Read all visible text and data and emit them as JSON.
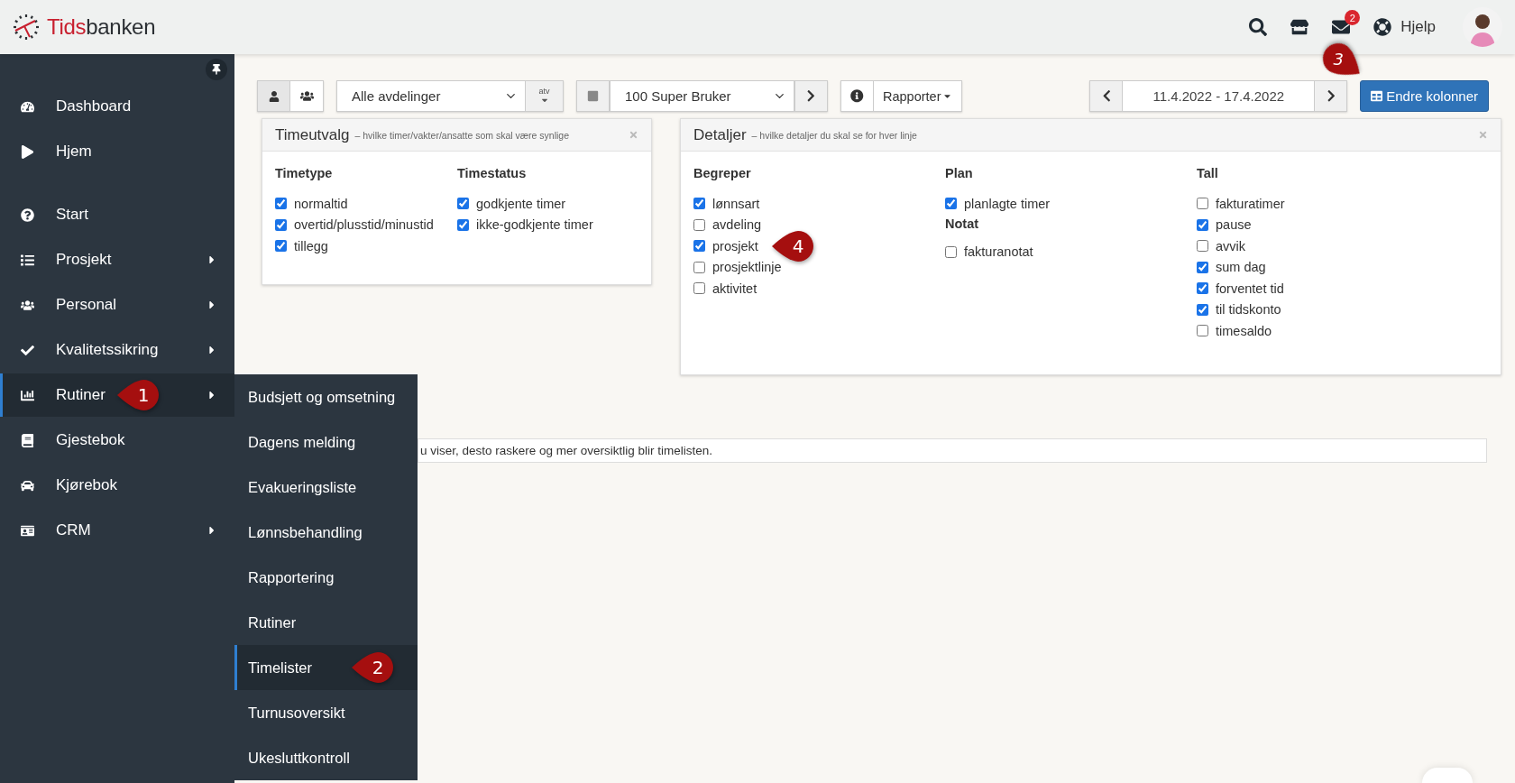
{
  "header": {
    "logo": [
      "Tids",
      "banken"
    ],
    "mail_badge": "2",
    "help": "Hjelp"
  },
  "sidebar": {
    "sections": [
      [
        {
          "label": "Dashboard",
          "submenu": false,
          "selected": false
        },
        {
          "label": "Hjem",
          "submenu": false,
          "selected": false
        }
      ],
      [
        {
          "label": "Start",
          "submenu": false,
          "selected": false
        },
        {
          "label": "Prosjekt",
          "submenu": true,
          "selected": false
        },
        {
          "label": "Personal",
          "submenu": true,
          "selected": false
        },
        {
          "label": "Kvalitetssikring",
          "submenu": true,
          "selected": false
        },
        {
          "label": "Rutiner",
          "submenu": true,
          "selected": true,
          "callout": "1"
        },
        {
          "label": "Gjestebok",
          "submenu": false,
          "selected": false
        },
        {
          "label": "Kjørebok",
          "submenu": false,
          "selected": false
        },
        {
          "label": "CRM",
          "submenu": true,
          "selected": false
        }
      ]
    ]
  },
  "submenu": {
    "items": [
      {
        "label": "Budsjett og omsetning",
        "selected": false
      },
      {
        "label": "Dagens melding",
        "selected": false
      },
      {
        "label": "Evakueringsliste",
        "selected": false
      },
      {
        "label": "Lønnsbehandling",
        "selected": false
      },
      {
        "label": "Rapportering",
        "selected": false
      },
      {
        "label": "Rutiner",
        "selected": false
      },
      {
        "label": "Timelister",
        "selected": true,
        "callout": "2"
      },
      {
        "label": "Turnusoversikt",
        "selected": false
      },
      {
        "label": "Ukesluttkontroll",
        "selected": false
      }
    ]
  },
  "toolbar": {
    "view_toggle": [
      {
        "selected": true
      },
      {
        "selected": false
      }
    ],
    "department": "Alle avdelinger",
    "atv": "atv",
    "user": "100 Super Bruker",
    "reports": "Rapporter",
    "date_range": "11.4.2022 - 17.4.2022",
    "columns_button": "Endre kolonner",
    "columns_callout": "3"
  },
  "panels": [
    {
      "title": "Timeutvalg",
      "subtitle": "– hvilke timer/vakter/ansatte som skal være synlige",
      "columns": [
        [
          {
            "heading": "Timetype",
            "items": [
              {
                "label": "normaltid",
                "checked": true
              },
              {
                "label": "overtid/plusstid/minustid",
                "checked": true
              },
              {
                "label": "tillegg",
                "checked": true
              }
            ]
          }
        ],
        [
          {
            "heading": "Timestatus",
            "items": [
              {
                "label": "godkjente timer",
                "checked": true
              },
              {
                "label": "ikke-godkjente timer",
                "checked": true
              }
            ]
          }
        ]
      ]
    },
    {
      "title": "Detaljer",
      "subtitle": "– hvilke detaljer du skal se for hver linje",
      "columns": [
        [
          {
            "heading": "Begreper",
            "items": [
              {
                "label": "lønnsart",
                "checked": true
              },
              {
                "label": "avdeling",
                "checked": false
              },
              {
                "label": "prosjekt",
                "checked": true,
                "callout": "4"
              },
              {
                "label": "prosjektlinje",
                "checked": false
              },
              {
                "label": "aktivitet",
                "checked": false
              }
            ]
          }
        ],
        [
          {
            "heading": "Plan",
            "items": [
              {
                "label": "planlagte timer",
                "checked": true
              }
            ]
          },
          {
            "heading": "Notat",
            "items": [
              {
                "label": "fakturanotat",
                "checked": false
              }
            ]
          }
        ],
        [
          {
            "heading": "Tall",
            "items": [
              {
                "label": "fakturatimer",
                "checked": false
              },
              {
                "label": "pause",
                "checked": true
              },
              {
                "label": "avvik",
                "checked": false
              },
              {
                "label": "sum dag",
                "checked": true
              },
              {
                "label": "forventet tid",
                "checked": true
              },
              {
                "label": "til tidskonto",
                "checked": true
              },
              {
                "label": "timesaldo",
                "checked": false
              }
            ]
          }
        ]
      ]
    }
  ],
  "info_text": "u viser, desto raskere og mer oversiktlig blir timelisten."
}
